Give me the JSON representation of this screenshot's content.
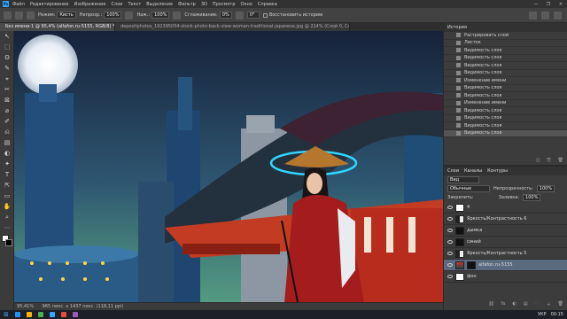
{
  "menubar": {
    "logo": "Ps",
    "items": [
      "Файл",
      "Редактирование",
      "Изображение",
      "Слои",
      "Текст",
      "Выделение",
      "Фильтр",
      "3D",
      "Просмотр",
      "Окно",
      "Справка"
    ],
    "window_controls": [
      "—",
      "❐",
      "✕"
    ]
  },
  "options": {
    "mode_label": "Режим:",
    "mode_value": "Кисть",
    "opacity_label": "Непрозр.:",
    "opacity_value": "100%",
    "pressure_label": "Наж.:",
    "pressure_value": "100%",
    "smoothing_label": "Сглаживание:",
    "smoothing_value": "0%",
    "angle_value": "0°",
    "restore_history": "Восстановить историю"
  },
  "tabs": [
    {
      "label": "Без имени-1 @ 95,4% (alfafon.ru-5155, RGB/8) *"
    },
    {
      "label": "depositphotos_192395054-stock-photo-back-view-woman-traditional-japanese.jpg @ 214% (Слой 0, Слой-маска/8) *"
    }
  ],
  "toolbar": {
    "tools": [
      "↖",
      "⬚",
      "ʘ",
      "✎",
      "⌖",
      "✂",
      "⊠",
      "⌀",
      "✐",
      "⎌",
      "▤",
      "◐",
      "✦",
      "T",
      "⇱",
      "▭",
      "✋",
      "⌕",
      "⋯"
    ]
  },
  "status": {
    "zoom": "95,41%",
    "doc_info": "965 пикс. x 1437 пикс. (118,11 ppi)"
  },
  "history": {
    "tabs": [
      "История"
    ],
    "items": [
      "Растрировать слой",
      "Листок",
      "Видимость слоя",
      "Видимость слоя",
      "Видимость слоя",
      "Видимость слоя",
      "Изменение имени",
      "Видимость слоя",
      "Видимость слоя",
      "Изменение имени",
      "Видимость слоя",
      "Видимость слоя",
      "Видимость слоя",
      "Видимость слоя"
    ],
    "bottom_buttons": [
      "◫",
      "⎘",
      "🗑"
    ]
  },
  "layers": {
    "tabs": [
      "Слои",
      "Каналы",
      "Контуры"
    ],
    "kind_label": "Вид",
    "blend_mode": "Обычные",
    "opacity_label": "Непрозрачность:",
    "opacity_value": "100%",
    "lock_label": "Закрепить:",
    "fill_label": "Заливка:",
    "fill_value": "100%",
    "rows": [
      {
        "name": "4",
        "thumb": "w"
      },
      {
        "name": "Яркость/Контрастность 6",
        "thumb": "adj"
      },
      {
        "name": "дымка",
        "thumb": "b"
      },
      {
        "name": "синий",
        "thumb": "b"
      },
      {
        "name": "Яркость/Контрастность 5",
        "thumb": "adj"
      },
      {
        "name": "alfafon.ru-5155",
        "thumb": "ph",
        "selected": true
      },
      {
        "name": "фон",
        "thumb": "w"
      }
    ],
    "bottom_buttons": [
      "⛓",
      "fx",
      "◐",
      "▤",
      "🗀",
      "＋",
      "🗑"
    ]
  },
  "taskbar": {
    "apps": [
      "#1e90ff",
      "#ffb300",
      "#4caf50",
      "#31a8ff",
      "#e74c3c",
      "#9b59b6"
    ],
    "lang": "УКР",
    "time": "00:15"
  }
}
